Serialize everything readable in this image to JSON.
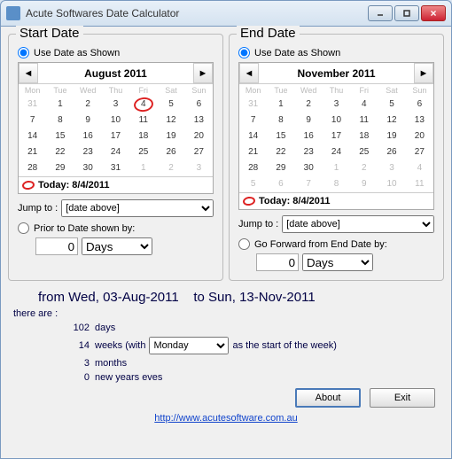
{
  "window": {
    "title": "Acute Softwares Date Calculator"
  },
  "start": {
    "panel_title": "Start Date",
    "use_shown": "Use Date as Shown",
    "month": "August 2011",
    "dows": [
      "Mon",
      "Tue",
      "Wed",
      "Thu",
      "Fri",
      "Sat",
      "Sun"
    ],
    "today_label": "Today: 8/4/2011",
    "jump_label": "Jump to :",
    "jump_value": "[date above]",
    "prior_label": "Prior to Date shown by:",
    "offset_value": "0",
    "offset_unit": "Days",
    "grid": [
      [
        {
          "n": "31",
          "dim": true
        },
        {
          "n": "1"
        },
        {
          "n": "2"
        },
        {
          "n": "3"
        },
        {
          "n": "4",
          "mark": true
        },
        {
          "n": "5"
        },
        {
          "n": "6"
        }
      ],
      [
        {
          "n": "7"
        },
        {
          "n": "8"
        },
        {
          "n": "9"
        },
        {
          "n": "10"
        },
        {
          "n": "11"
        },
        {
          "n": "12"
        },
        {
          "n": "13"
        }
      ],
      [
        {
          "n": "14"
        },
        {
          "n": "15"
        },
        {
          "n": "16"
        },
        {
          "n": "17"
        },
        {
          "n": "18"
        },
        {
          "n": "19"
        },
        {
          "n": "20"
        }
      ],
      [
        {
          "n": "21"
        },
        {
          "n": "22"
        },
        {
          "n": "23"
        },
        {
          "n": "24"
        },
        {
          "n": "25"
        },
        {
          "n": "26"
        },
        {
          "n": "27"
        }
      ],
      [
        {
          "n": "28"
        },
        {
          "n": "29"
        },
        {
          "n": "30"
        },
        {
          "n": "31"
        },
        {
          "n": "1",
          "dim": true
        },
        {
          "n": "2",
          "dim": true
        },
        {
          "n": "3",
          "dim": true
        }
      ]
    ]
  },
  "end": {
    "panel_title": "End Date",
    "use_shown": "Use Date as Shown",
    "month": "November 2011",
    "dows": [
      "Mon",
      "Tue",
      "Wed",
      "Thu",
      "Fri",
      "Sat",
      "Sun"
    ],
    "today_label": "Today: 8/4/2011",
    "jump_label": "Jump to :",
    "jump_value": "[date above]",
    "forward_label": "Go Forward from End Date by:",
    "offset_value": "0",
    "offset_unit": "Days",
    "grid": [
      [
        {
          "n": "31",
          "dim": true
        },
        {
          "n": "1"
        },
        {
          "n": "2"
        },
        {
          "n": "3"
        },
        {
          "n": "4"
        },
        {
          "n": "5"
        },
        {
          "n": "6"
        }
      ],
      [
        {
          "n": "7"
        },
        {
          "n": "8"
        },
        {
          "n": "9"
        },
        {
          "n": "10"
        },
        {
          "n": "11"
        },
        {
          "n": "12"
        },
        {
          "n": "13"
        }
      ],
      [
        {
          "n": "14"
        },
        {
          "n": "15"
        },
        {
          "n": "16"
        },
        {
          "n": "17"
        },
        {
          "n": "18"
        },
        {
          "n": "19"
        },
        {
          "n": "20"
        }
      ],
      [
        {
          "n": "21"
        },
        {
          "n": "22"
        },
        {
          "n": "23"
        },
        {
          "n": "24"
        },
        {
          "n": "25"
        },
        {
          "n": "26"
        },
        {
          "n": "27"
        }
      ],
      [
        {
          "n": "28"
        },
        {
          "n": "29"
        },
        {
          "n": "30"
        },
        {
          "n": "1",
          "dim": true
        },
        {
          "n": "2",
          "dim": true
        },
        {
          "n": "3",
          "dim": true
        },
        {
          "n": "4",
          "dim": true
        }
      ],
      [
        {
          "n": "5",
          "dim": true
        },
        {
          "n": "6",
          "dim": true
        },
        {
          "n": "7",
          "dim": true
        },
        {
          "n": "8",
          "dim": true
        },
        {
          "n": "9",
          "dim": true
        },
        {
          "n": "10",
          "dim": true
        },
        {
          "n": "11",
          "dim": true
        }
      ]
    ]
  },
  "results": {
    "from": "from Wed, 03-Aug-2011",
    "to": "to Sun, 13-Nov-2011",
    "there_are": "there are :",
    "days_n": "102",
    "days_l": "days",
    "weeks_n": "14",
    "weeks_pre": "weeks (with",
    "weeks_post": "as the start of the week)",
    "week_start": "Monday",
    "months_n": "3",
    "months_l": "months",
    "nye_n": "0",
    "nye_l": "new years eves"
  },
  "footer": {
    "about": "About",
    "exit": "Exit",
    "url": "http://www.acutesoftware.com.au"
  }
}
